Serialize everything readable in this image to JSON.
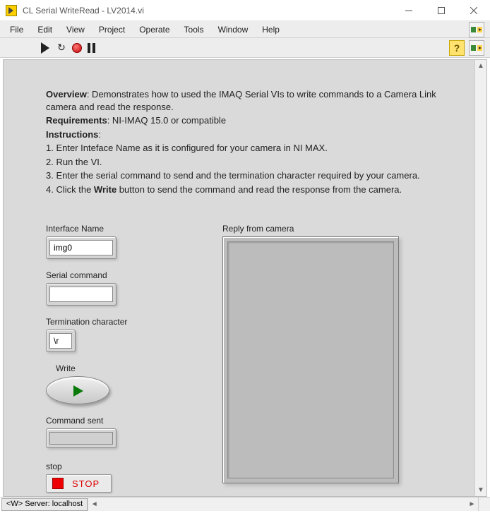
{
  "window": {
    "title": "CL Serial WriteRead - LV2014.vi"
  },
  "menu": {
    "items": [
      "File",
      "Edit",
      "View",
      "Project",
      "Operate",
      "Tools",
      "Window",
      "Help"
    ]
  },
  "toolbar": {
    "run": "run",
    "run_cont": "run-continuously",
    "abort": "abort",
    "pause": "pause",
    "help": "?"
  },
  "intro": {
    "overview_label": "Overview",
    "overview_text": ": Demonstrates how to used the IMAQ Serial VIs to write commands to a Camera Link camera and read the response.",
    "req_label": "Requirements",
    "req_text": ": NI-IMAQ 15.0 or compatible",
    "instr_label": "Instructions",
    "instr1": "1. Enter Inteface Name as it is configured for your camera in NI MAX.",
    "instr2": "2. Run the VI.",
    "instr3": "3. Enter the serial command to send and the termination character required by your camera.",
    "instr4_a": "4. Click the ",
    "instr4_b": "Write",
    "instr4_c": " button to send the command and read the response from the camera."
  },
  "fields": {
    "interface_label": "Interface Name",
    "interface_value": "img0",
    "serial_label": "Serial command",
    "serial_value": "",
    "term_label": "Termination character",
    "term_value": "\\r",
    "write_label": "Write",
    "cmdsent_label": "Command sent",
    "cmdsent_value": "",
    "stop_label": "stop",
    "stop_btn": "STOP",
    "reply_label": "Reply from camera",
    "reply_value": ""
  },
  "status": {
    "text": "<W> Server: localhost"
  }
}
